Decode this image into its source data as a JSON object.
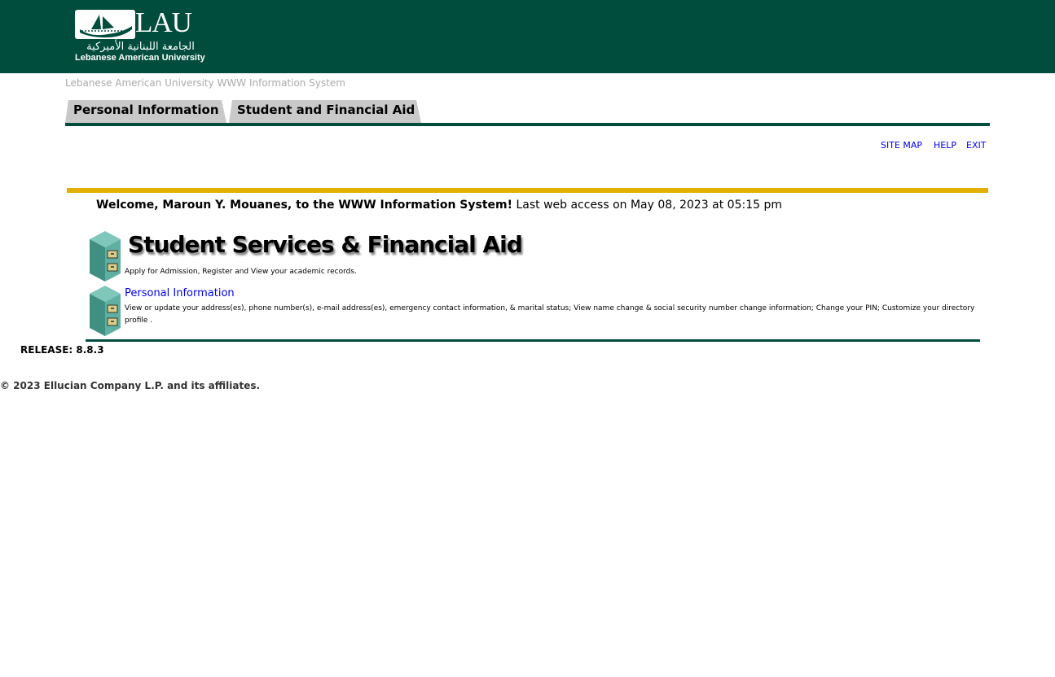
{
  "header": {
    "logo_text": "LAU",
    "logo_arabic": "الجامعة اللبنانية الأميركية",
    "logo_subtitle": "Lebanese American University",
    "brand_color": "#004d3d"
  },
  "system_title": "Lebanese American University WWW Information System",
  "tabs": [
    {
      "label": "Personal Information"
    },
    {
      "label": "Student and Financial Aid"
    }
  ],
  "toplinks": {
    "site_map": "SITE MAP",
    "help": "HELP",
    "exit": "EXIT"
  },
  "welcome": {
    "greeting": "Welcome, Maroun Y. Mouanes, to the WWW Information System!",
    "last_access": "Last web access on May 08, 2023 at 05:15 pm"
  },
  "menu": {
    "heading": "Student Services & Financial Aid",
    "heading_desc": "Apply for Admission, Register and View your academic records.",
    "items": [
      {
        "label": "Personal Information",
        "desc": "View or update your address(es), phone number(s), e-mail address(es), emergency contact information, & marital status; View name change & social security number change information; Change your PIN; Customize your directory profile ."
      }
    ]
  },
  "footer": {
    "release": "RELEASE: 8.8.3",
    "copyright": "© 2023 Ellucian Company L.P. and its affiliates."
  },
  "colors": {
    "accent_gold": "#e2b000",
    "link": "#0000ee",
    "tab_bg": "#c9c9c9"
  }
}
